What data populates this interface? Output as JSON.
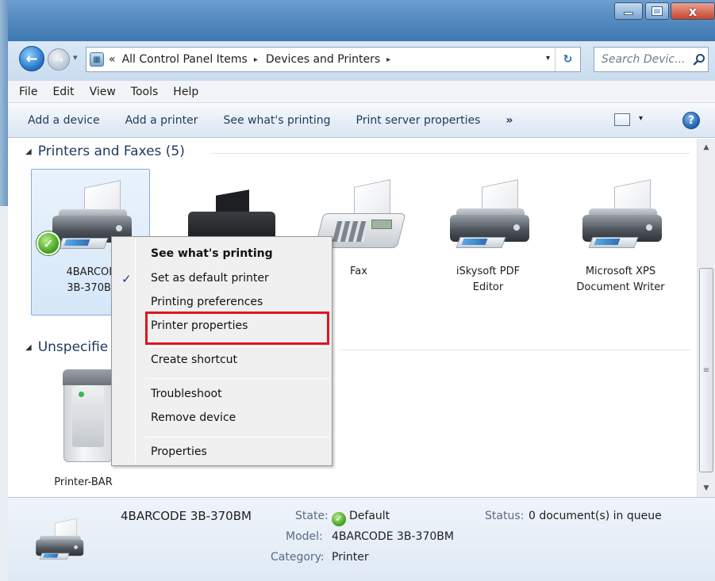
{
  "window": {
    "minimize_glyph": "",
    "close_glyph": "x"
  },
  "address": {
    "back_glyph": "←",
    "forward_glyph": "→",
    "overflow": "«",
    "crumbs": [
      "All Control Panel Items",
      "Devices and Printers"
    ],
    "separator": "▸",
    "dropdown": "▾",
    "refresh_glyph": "↻"
  },
  "search": {
    "placeholder": "Search Devic...",
    "icon": "search-icon"
  },
  "menu": {
    "items": [
      "File",
      "Edit",
      "View",
      "Tools",
      "Help"
    ]
  },
  "commands": {
    "items": [
      "Add a device",
      "Add a printer",
      "See what's printing",
      "Print server properties"
    ],
    "more": "»",
    "view_dropdown": "▾",
    "help": "?"
  },
  "groups": [
    {
      "title": "Printers and Faxes (5)",
      "arrow": "◢"
    },
    {
      "title": "Unspecifie",
      "arrow": "◢"
    }
  ],
  "devices": [
    {
      "label_line1": "4BARCOL",
      "label_line2": "3B-370BI",
      "selected": true,
      "default": true
    },
    {
      "label_line1": "",
      "label_line2": ""
    },
    {
      "label_line1": "Fax",
      "label_line2": ""
    },
    {
      "label_line1": "iSkysoft PDF",
      "label_line2": "Editor"
    },
    {
      "label_line1": "Microsoft XPS",
      "label_line2": "Document Writer"
    }
  ],
  "unspecified_devices": [
    {
      "label": "Printer-BAR"
    }
  ],
  "context_menu": {
    "items": [
      {
        "label": "See what's printing",
        "bold": true
      },
      {
        "label": "Set as default printer",
        "checked": true
      },
      {
        "label": "Printing preferences"
      },
      {
        "label": "Printer properties",
        "highlighted": true
      },
      {
        "label": "Create shortcut"
      },
      {
        "label": "Troubleshoot"
      },
      {
        "label": "Remove device"
      },
      {
        "label": "Properties"
      }
    ],
    "check_glyph": "✓",
    "highlight_color": "#e0151d"
  },
  "scrollbar": {
    "up": "▲",
    "down": "▼",
    "grip": "≡"
  },
  "details": {
    "name": "4BARCODE 3B-370BM",
    "state_label": "State:",
    "state_value": "Default",
    "model_label": "Model:",
    "model_value": "4BARCODE 3B-370BM",
    "category_label": "Category:",
    "category_value": "Printer",
    "status_label": "Status:",
    "status_value": "0 document(s) in queue"
  },
  "colors": {
    "title_bar": "#4f86bd",
    "command_bar_text": "#1f3a5a",
    "group_header_text": "#1e3a5f",
    "selected_item_border": "#84acdd"
  }
}
